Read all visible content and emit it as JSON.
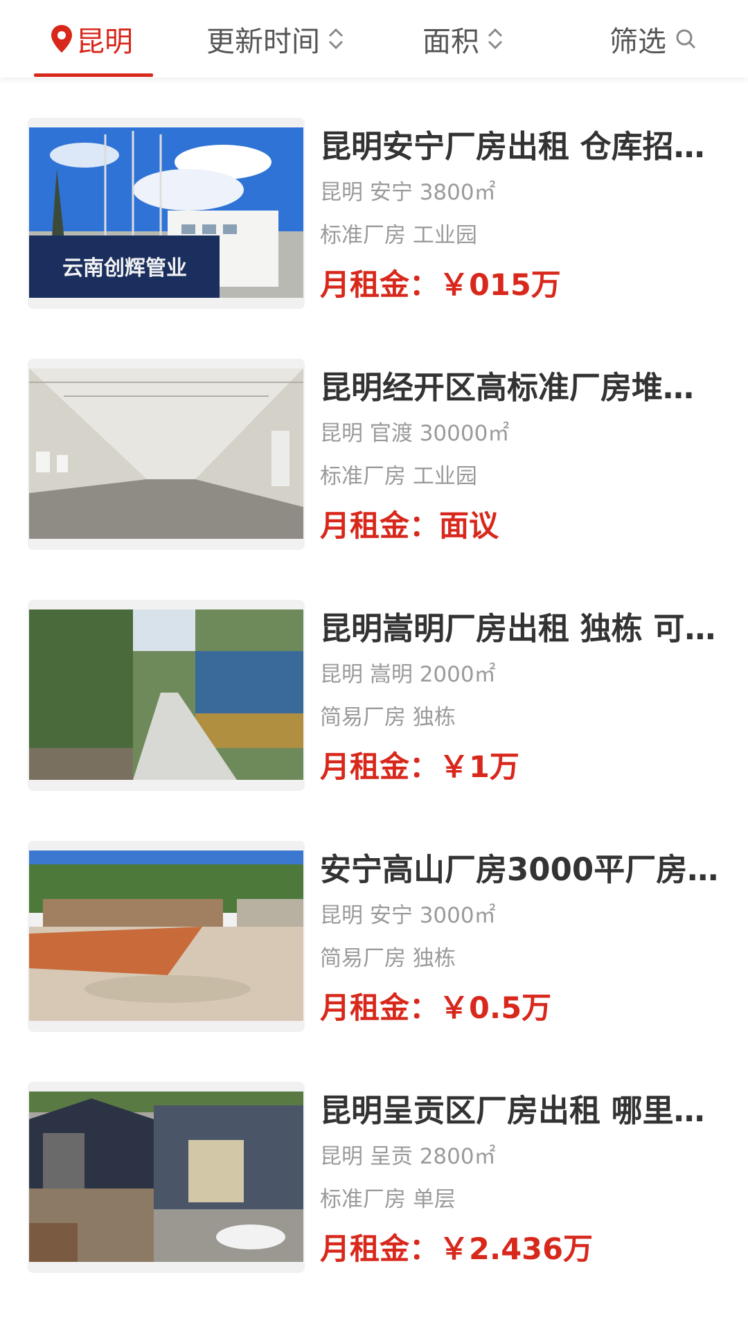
{
  "filters": {
    "city": "昆明",
    "update_time": "更新时间",
    "area": "面积",
    "filter": "筛选"
  },
  "colors": {
    "accent": "#d8281c",
    "title": "#333333",
    "meta": "#9a9a9a"
  },
  "icons": {
    "location": "location-pin-icon",
    "sort": "sort-updown-icon",
    "search": "search-icon"
  },
  "listings": [
    {
      "title": "昆明安宁厂房出租 仓库招…",
      "location": "昆明 安宁 3800㎡",
      "tags": "标准厂房 工业园",
      "price": "月租金：￥015万",
      "image_text": "云南创辉管业"
    },
    {
      "title": "昆明经开区高标准厂房堆…",
      "location": "昆明 官渡 30000㎡",
      "tags": "标准厂房 工业园",
      "price": "月租金：面议"
    },
    {
      "title": "昆明嵩明厂房出租 独栋 可…",
      "location": "昆明 嵩明 2000㎡",
      "tags": "简易厂房 独栋",
      "price": "月租金：￥1万"
    },
    {
      "title": "安宁高山厂房3000平厂房…",
      "location": "昆明 安宁 3000㎡",
      "tags": "简易厂房 独栋",
      "price": "月租金：￥0.5万"
    },
    {
      "title": "昆明呈贡区厂房出租 哪里…",
      "location": "昆明 呈贡 2800㎡",
      "tags": "标准厂房 单层",
      "price": "月租金：￥2.436万"
    }
  ]
}
